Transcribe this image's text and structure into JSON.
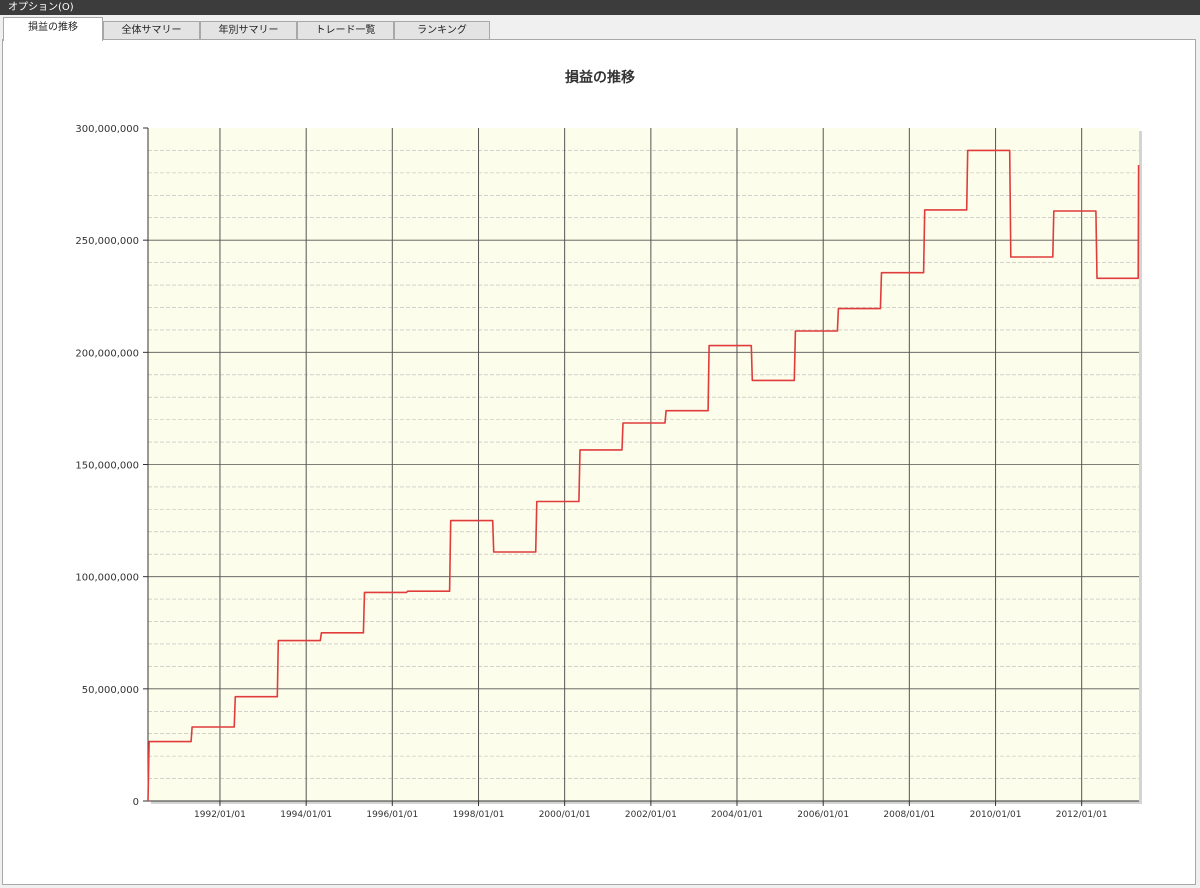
{
  "menubar": {
    "options_label": "オプション(O)"
  },
  "tabs": [
    {
      "label": "損益の推移",
      "active": true
    },
    {
      "label": "全体サマリー",
      "active": false
    },
    {
      "label": "年別サマリー",
      "active": false
    },
    {
      "label": "トレード一覧",
      "active": false
    },
    {
      "label": "ランキング",
      "active": false
    }
  ],
  "colors": {
    "plot_bg": "#fdfdeb",
    "line": "#e03c3c",
    "major_grid": "#555555",
    "minor_grid": "#b8b8b8"
  },
  "chart_data": {
    "type": "line",
    "title": "損益の推移",
    "xlabel": "",
    "ylabel": "",
    "ylim": [
      0,
      300000000
    ],
    "xlim": [
      "1990-05-01",
      "2013-05-01"
    ],
    "y_ticks": [
      "0",
      "50,000,000",
      "100,000,000",
      "150,000,000",
      "200,000,000",
      "250,000,000",
      "300,000,000"
    ],
    "x_ticks": [
      "1992/01/01",
      "1994/01/01",
      "1996/01/01",
      "1998/01/01",
      "2000/01/01",
      "2002/01/01",
      "2004/01/01",
      "2006/01/01",
      "2008/01/01",
      "2010/01/01",
      "2012/01/01"
    ],
    "grid": true,
    "series": [
      {
        "points": [
          [
            "1990-05-01",
            0
          ],
          [
            "1990-05-10",
            26500000
          ],
          [
            "1991-05-01",
            26500000
          ],
          [
            "1991-05-10",
            33000000
          ],
          [
            "1992-05-01",
            33000000
          ],
          [
            "1992-05-10",
            46500000
          ],
          [
            "1993-05-01",
            46500000
          ],
          [
            "1993-05-10",
            71500000
          ],
          [
            "1994-05-01",
            71500000
          ],
          [
            "1994-05-10",
            75000000
          ],
          [
            "1995-05-01",
            75000000
          ],
          [
            "1995-05-10",
            93000000
          ],
          [
            "1996-05-01",
            93000000
          ],
          [
            "1996-05-10",
            93500000
          ],
          [
            "1997-05-01",
            93500000
          ],
          [
            "1997-05-10",
            125000000
          ],
          [
            "1998-05-01",
            125000000
          ],
          [
            "1998-05-10",
            111000000
          ],
          [
            "1999-05-01",
            111000000
          ],
          [
            "1999-05-10",
            133500000
          ],
          [
            "2000-05-01",
            133500000
          ],
          [
            "2000-05-10",
            156500000
          ],
          [
            "2001-05-01",
            156500000
          ],
          [
            "2001-05-10",
            168500000
          ],
          [
            "2002-05-01",
            168500000
          ],
          [
            "2002-05-10",
            174000000
          ],
          [
            "2003-05-01",
            174000000
          ],
          [
            "2003-05-10",
            203000000
          ],
          [
            "2004-05-01",
            203000000
          ],
          [
            "2004-05-10",
            187500000
          ],
          [
            "2005-05-01",
            187500000
          ],
          [
            "2005-05-10",
            209500000
          ],
          [
            "2006-05-01",
            209500000
          ],
          [
            "2006-05-10",
            219500000
          ],
          [
            "2007-05-01",
            219500000
          ],
          [
            "2007-05-10",
            235500000
          ],
          [
            "2008-05-01",
            235500000
          ],
          [
            "2008-05-10",
            263500000
          ],
          [
            "2009-05-01",
            263500000
          ],
          [
            "2009-05-10",
            290000000
          ],
          [
            "2010-05-01",
            290000000
          ],
          [
            "2010-05-10",
            242500000
          ],
          [
            "2011-05-01",
            242500000
          ],
          [
            "2011-05-10",
            263000000
          ],
          [
            "2012-05-01",
            263000000
          ],
          [
            "2012-05-10",
            233000000
          ],
          [
            "2013-04-24",
            233000000
          ],
          [
            "2013-04-28",
            283500000
          ]
        ]
      }
    ]
  }
}
